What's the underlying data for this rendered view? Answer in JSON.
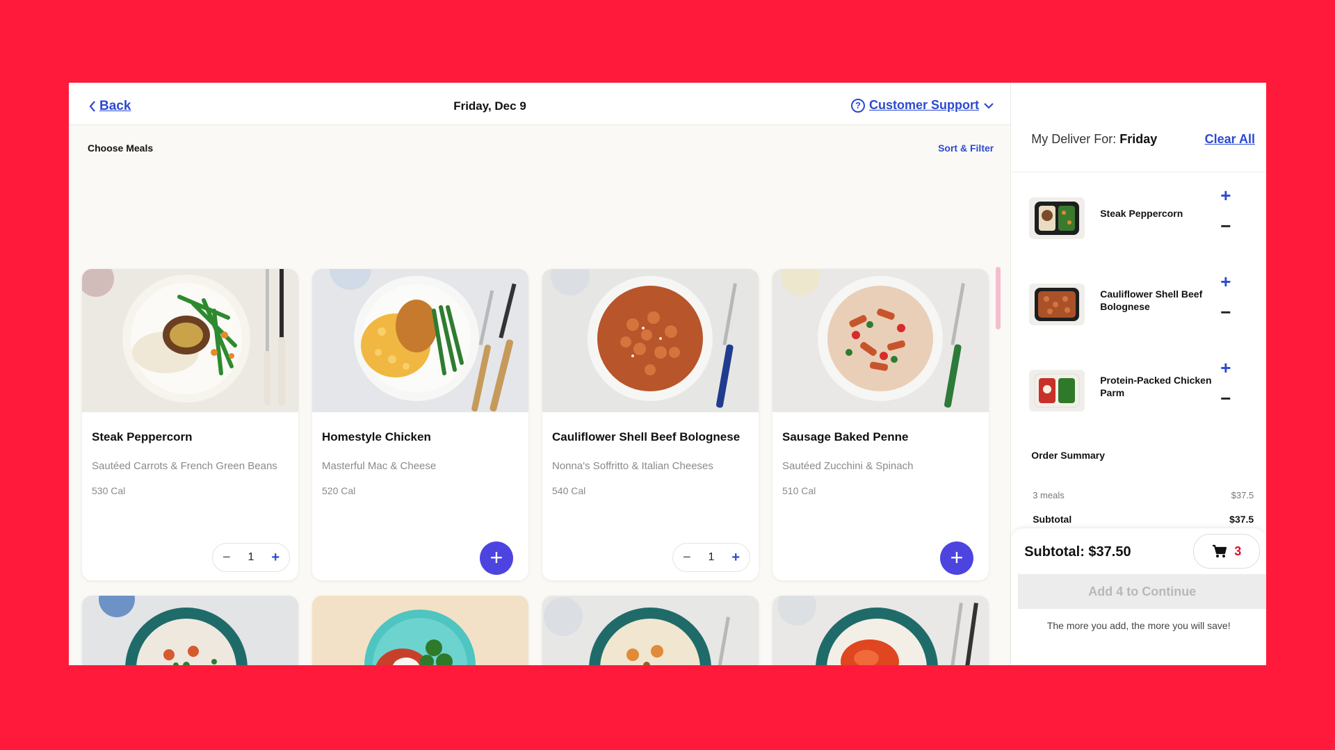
{
  "header": {
    "back_label": "Back",
    "date_title": "Friday, Dec 9",
    "support_label": "Customer Support"
  },
  "subheader": {
    "choose_label": "Choose Meals",
    "sort_filter_label": "Sort & Filter"
  },
  "meals": [
    {
      "name": "Steak Peppercorn",
      "desc": "Sautéed Carrots & French Green Beans",
      "cal": "530 Cal",
      "qty": "1"
    },
    {
      "name": "Homestyle Chicken",
      "desc": "Masterful Mac & Cheese",
      "cal": "520 Cal"
    },
    {
      "name": "Cauliflower Shell Beef Bolognese",
      "desc": "Nonna's Soffritto & Italian Cheeses",
      "cal": "540 Cal",
      "qty": "1"
    },
    {
      "name": "Sausage Baked Penne",
      "desc": "Sautéed Zucchini & Spinach",
      "cal": "510 Cal"
    }
  ],
  "sidebar": {
    "deliver_prefix": "My Deliver For:",
    "deliver_day": "Friday",
    "clear_all_label": "Clear All",
    "cart_items": [
      {
        "name": "Steak Peppercorn"
      },
      {
        "name": "Cauliflower Shell Beef Bolognese"
      },
      {
        "name": "Protein-Packed Chicken Parm"
      }
    ],
    "order_summary_label": "Order Summary",
    "meals_count_label": "3 meals",
    "meals_price": "$37.5",
    "subtotal_label": "Subtotal",
    "subtotal_value": "$37.5",
    "subtotal_big": "Subtotal: $37.50",
    "cart_count": "3",
    "continue_label": "Add 4 to Continue",
    "save_note": "The more you add, the more you will save!"
  },
  "colors": {
    "background": "#ff1a3b",
    "accent": "#2b4ad0",
    "add_button": "#4d44e0"
  }
}
